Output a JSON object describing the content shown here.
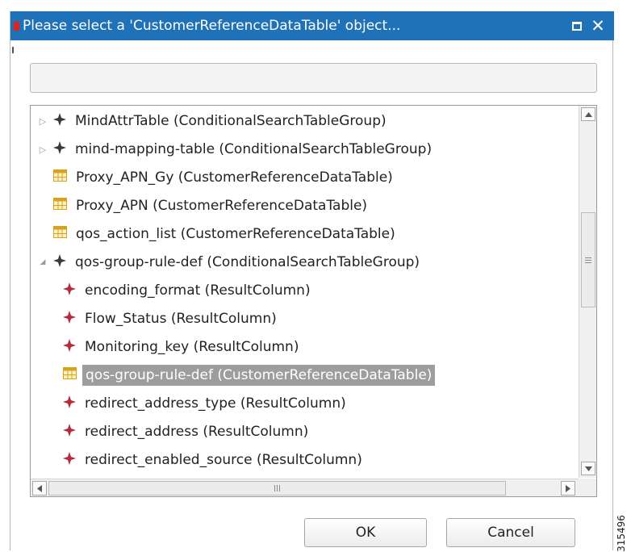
{
  "dialog": {
    "title": "Please select a 'CustomerReferenceDataTable' object...",
    "search": {
      "value": "",
      "placeholder": ""
    },
    "ok_label": "OK",
    "cancel_label": "Cancel"
  },
  "tree": {
    "items": [
      {
        "label": "MindAttrTable (ConditionalSearchTableGroup)",
        "icon": "group-icon",
        "expander": "collapsed",
        "level": 0
      },
      {
        "label": "mind-mapping-table (ConditionalSearchTableGroup)",
        "icon": "group-icon",
        "expander": "collapsed",
        "level": 0
      },
      {
        "label": "Proxy_APN_Gy (CustomerReferenceDataTable)",
        "icon": "table-icon",
        "expander": "none",
        "level": 0
      },
      {
        "label": "Proxy_APN (CustomerReferenceDataTable)",
        "icon": "table-icon",
        "expander": "none",
        "level": 0
      },
      {
        "label": "qos_action_list (CustomerReferenceDataTable)",
        "icon": "table-icon",
        "expander": "none",
        "level": 0
      },
      {
        "label": "qos-group-rule-def (ConditionalSearchTableGroup)",
        "icon": "group-icon",
        "expander": "expanded",
        "level": 0
      },
      {
        "label": "encoding_format (ResultColumn)",
        "icon": "column-icon",
        "expander": "none",
        "level": 1
      },
      {
        "label": "Flow_Status (ResultColumn)",
        "icon": "column-icon",
        "expander": "none",
        "level": 1
      },
      {
        "label": "Monitoring_key (ResultColumn)",
        "icon": "column-icon",
        "expander": "none",
        "level": 1
      },
      {
        "label": "qos-group-rule-def (CustomerReferenceDataTable)",
        "icon": "table-icon",
        "expander": "none",
        "level": 1,
        "selected": true
      },
      {
        "label": "redirect_address_type (ResultColumn)",
        "icon": "column-icon",
        "expander": "none",
        "level": 1
      },
      {
        "label": "redirect_address (ResultColumn)",
        "icon": "column-icon",
        "expander": "none",
        "level": 1
      },
      {
        "label": "redirect_enabled_source (ResultColumn)",
        "icon": "column-icon",
        "expander": "none",
        "level": 1
      }
    ]
  },
  "figure_id": "315496",
  "colors": {
    "titlebar": "#1f72b8",
    "title_marker": "#e2231a",
    "selection": "#9d9d9d",
    "column_icon": "#b5293a",
    "table_icon": "#d9a21c"
  }
}
